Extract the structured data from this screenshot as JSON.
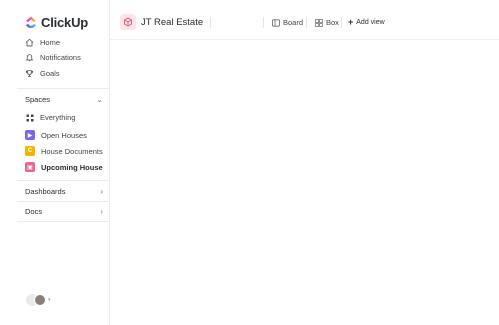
{
  "brand": {
    "name": "ClickUp"
  },
  "sidebar": {
    "nav": [
      {
        "label": "Home",
        "icon": "home-icon"
      },
      {
        "label": "Notifications",
        "icon": "bell-icon"
      },
      {
        "label": "Goals",
        "icon": "trophy-icon"
      }
    ],
    "spaces": {
      "title": "Spaces",
      "everything_label": "Everything",
      "items": [
        {
          "label": "Open Houses",
          "badge": "▶",
          "color": "#7b68ee"
        },
        {
          "label": "House Documents",
          "badge": "C",
          "color": "#f5b400"
        },
        {
          "label": "Upcoming House",
          "badge": "▣",
          "color": "#f0658f",
          "active": true
        }
      ]
    },
    "dashboards_label": "Dashboards",
    "docs_label": "Docs"
  },
  "header": {
    "project_title": "JT Real Estate",
    "views": [
      {
        "label": "Board",
        "icon": "board-icon"
      },
      {
        "label": "Box",
        "icon": "box-grid-icon"
      }
    ],
    "add_view_label": "Add view"
  }
}
